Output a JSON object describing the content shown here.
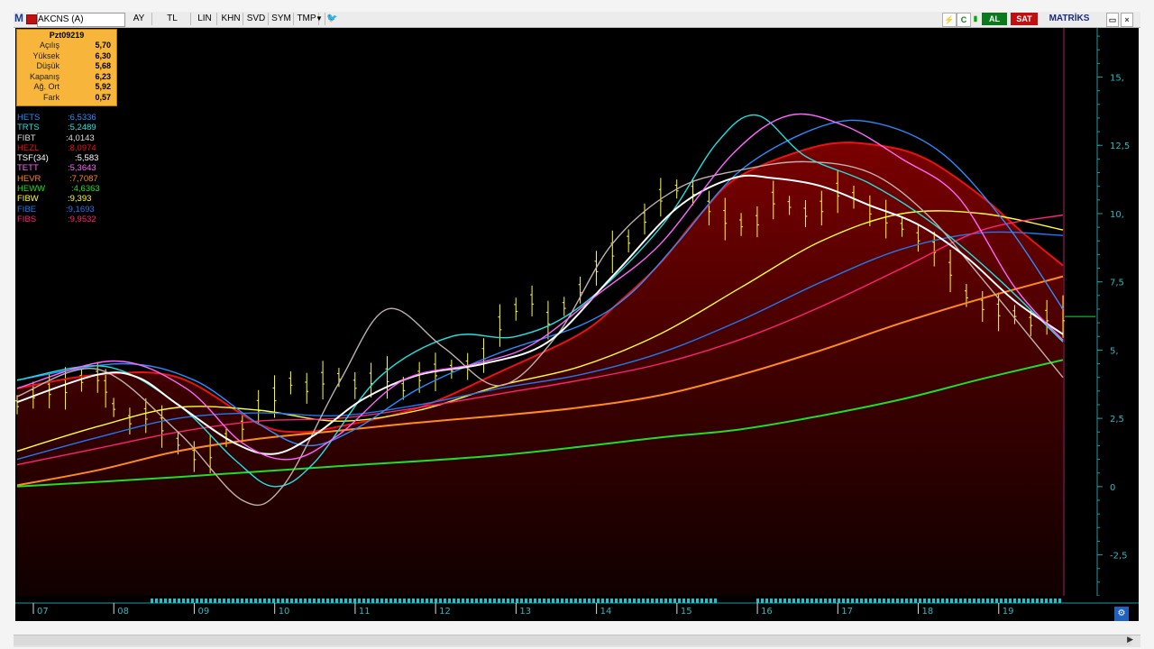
{
  "toolbar": {
    "logo": "M",
    "symbol": "AKCNS (A)",
    "buttons": [
      "AY",
      "TL",
      "LIN",
      "KHN",
      "SVD",
      "SYM",
      "TMP"
    ],
    "buy_label": "AL",
    "sell_label": "SAT",
    "brand": "MATRİKS",
    "colors": {
      "buy": "#0a7a1c",
      "sell": "#c01010",
      "brand": "#1a2a7a"
    }
  },
  "info_box": {
    "title": "Pzt09219",
    "rows": [
      {
        "label": "Açılış",
        "value": "5,70"
      },
      {
        "label": "Yüksek",
        "value": "6,30"
      },
      {
        "label": "Düşük",
        "value": "5,68"
      },
      {
        "label": "Kapanış",
        "value": "6,23"
      },
      {
        "label": "Ağ. Ort",
        "value": "5,92"
      },
      {
        "label": "Fark",
        "value": "0,57"
      }
    ]
  },
  "legend": [
    {
      "name": "HETS",
      "value": ":6,5336",
      "color": "#2a8cff"
    },
    {
      "name": "TRTS",
      "value": ":5,2489",
      "color": "#22e0e0"
    },
    {
      "name": "FIBT",
      "value": ":4,0143",
      "color": "#dddddd"
    },
    {
      "name": "HEZL",
      "value": ":8,0974",
      "color": "#ee1111"
    },
    {
      "name": "TSF(34)",
      "value": ":5,583",
      "color": "#ffffff"
    },
    {
      "name": "TETT",
      "value": ":5,3643",
      "color": "#ff66ff"
    },
    {
      "name": "HEVR",
      "value": ":7,7087",
      "color": "#ff8c1a"
    },
    {
      "name": "HEWW",
      "value": ":4,6363",
      "color": "#22dd22"
    },
    {
      "name": "FIBW",
      "value": ":9,393",
      "color": "#ffff33"
    },
    {
      "name": "FIBE",
      "value": ":9,1693",
      "color": "#2277ee"
    },
    {
      "name": "FIBS",
      "value": ":9,9532",
      "color": "#ff2277"
    }
  ],
  "chart_data": {
    "type": "line",
    "y_ticks": [
      "15,",
      "12,5",
      "10,",
      "7,5",
      "5,",
      "2,5",
      "0",
      "-2,5"
    ],
    "x_ticks": [
      "07",
      "08",
      "09",
      "10",
      "11",
      "12",
      "13",
      "14",
      "15",
      "16",
      "17",
      "18",
      "19"
    ],
    "ylim": [
      -4,
      16.8
    ],
    "x_range": [
      0,
      13
    ],
    "grid": false,
    "price_bars": {
      "points": [
        [
          0.0,
          3.0
        ],
        [
          0.2,
          3.35
        ],
        [
          0.4,
          3.5
        ],
        [
          0.6,
          3.6
        ],
        [
          0.8,
          3.9
        ],
        [
          1.0,
          4.0
        ],
        [
          1.1,
          3.6
        ],
        [
          1.2,
          2.9
        ],
        [
          1.4,
          2.4
        ],
        [
          1.6,
          2.6
        ],
        [
          1.8,
          2.2
        ],
        [
          2.0,
          1.6
        ],
        [
          2.2,
          1.1
        ],
        [
          2.4,
          1.2
        ],
        [
          2.6,
          1.8
        ],
        [
          2.8,
          2.2
        ],
        [
          3.0,
          2.9
        ],
        [
          3.2,
          3.3
        ],
        [
          3.4,
          3.8
        ],
        [
          3.6,
          3.6
        ],
        [
          3.8,
          3.9
        ],
        [
          4.0,
          4.0
        ],
        [
          4.2,
          3.7
        ],
        [
          4.4,
          3.9
        ],
        [
          4.6,
          4.0
        ],
        [
          4.8,
          3.6
        ],
        [
          5.0,
          4.0
        ],
        [
          5.2,
          4.2
        ],
        [
          5.4,
          4.3
        ],
        [
          5.6,
          4.4
        ],
        [
          5.8,
          4.8
        ],
        [
          6.0,
          5.9
        ],
        [
          6.2,
          6.5
        ],
        [
          6.4,
          6.8
        ],
        [
          6.6,
          6.1
        ],
        [
          6.8,
          6.6
        ],
        [
          7.0,
          7.2
        ],
        [
          7.2,
          8.0
        ],
        [
          7.4,
          8.6
        ],
        [
          7.6,
          9.0
        ],
        [
          7.8,
          9.8
        ],
        [
          8.0,
          10.6
        ],
        [
          8.2,
          10.9
        ],
        [
          8.4,
          10.8
        ],
        [
          8.6,
          10.2
        ],
        [
          8.8,
          9.8
        ],
        [
          9.0,
          9.6
        ],
        [
          9.2,
          9.7
        ],
        [
          9.4,
          10.5
        ],
        [
          9.6,
          10.3
        ],
        [
          9.8,
          10.0
        ],
        [
          10.0,
          10.2
        ],
        [
          10.2,
          10.8
        ],
        [
          10.4,
          10.6
        ],
        [
          10.6,
          10.1
        ],
        [
          10.8,
          9.8
        ],
        [
          11.0,
          9.5
        ],
        [
          11.2,
          9.1
        ],
        [
          11.4,
          8.7
        ],
        [
          11.6,
          7.9
        ],
        [
          11.8,
          7.0
        ],
        [
          12.0,
          6.6
        ],
        [
          12.2,
          6.4
        ],
        [
          12.4,
          6.3
        ],
        [
          12.6,
          6.0
        ],
        [
          12.8,
          6.2
        ],
        [
          13.0,
          6.23
        ]
      ],
      "color": "#ffff33"
    },
    "series": [
      {
        "name": "HEZL",
        "color": "#ee1111",
        "values": [
          [
            0,
            3.6
          ],
          [
            1,
            4.1
          ],
          [
            2,
            4.0
          ],
          [
            3,
            2.3
          ],
          [
            3.5,
            2.0
          ],
          [
            4,
            2.2
          ],
          [
            5,
            2.9
          ],
          [
            6,
            4.2
          ],
          [
            7,
            5.6
          ],
          [
            7.5,
            6.8
          ],
          [
            8,
            8.2
          ],
          [
            8.5,
            10.0
          ],
          [
            9,
            11.4
          ],
          [
            10,
            12.5
          ],
          [
            10.7,
            12.5
          ],
          [
            11.3,
            12.0
          ],
          [
            12,
            10.6
          ],
          [
            12.5,
            9.3
          ],
          [
            13,
            8.1
          ]
        ]
      },
      {
        "name": "HEVR",
        "color": "#ff8c1a",
        "values": [
          [
            0,
            0.05
          ],
          [
            1,
            0.6
          ],
          [
            2,
            1.3
          ],
          [
            3,
            1.75
          ],
          [
            4,
            2.05
          ],
          [
            5,
            2.35
          ],
          [
            6,
            2.6
          ],
          [
            7,
            2.9
          ],
          [
            8,
            3.35
          ],
          [
            9,
            4.1
          ],
          [
            10,
            5.0
          ],
          [
            11,
            6.0
          ],
          [
            12,
            6.9
          ],
          [
            13,
            7.7
          ]
        ]
      },
      {
        "name": "HEWW",
        "color": "#22dd22",
        "values": [
          [
            0,
            0.0
          ],
          [
            2,
            0.35
          ],
          [
            4,
            0.75
          ],
          [
            6,
            1.15
          ],
          [
            8,
            1.8
          ],
          [
            9,
            2.1
          ],
          [
            10,
            2.6
          ],
          [
            11,
            3.2
          ],
          [
            12,
            3.95
          ],
          [
            13,
            4.64
          ]
        ]
      },
      {
        "name": "FIBW",
        "color": "#ffff33",
        "values": [
          [
            0,
            1.3
          ],
          [
            1,
            2.2
          ],
          [
            2,
            2.9
          ],
          [
            3,
            2.8
          ],
          [
            4,
            2.4
          ],
          [
            5,
            2.8
          ],
          [
            6,
            3.7
          ],
          [
            7,
            4.4
          ],
          [
            8,
            5.6
          ],
          [
            9,
            7.3
          ],
          [
            10,
            9.0
          ],
          [
            11,
            10.0
          ],
          [
            12,
            10.0
          ],
          [
            13,
            9.4
          ]
        ]
      },
      {
        "name": "FIBE",
        "color": "#2277ee",
        "values": [
          [
            0,
            1.0
          ],
          [
            1,
            1.8
          ],
          [
            2,
            2.5
          ],
          [
            3,
            2.7
          ],
          [
            4,
            2.6
          ],
          [
            5,
            3.0
          ],
          [
            6,
            3.6
          ],
          [
            7,
            4.1
          ],
          [
            8,
            4.9
          ],
          [
            9,
            6.1
          ],
          [
            10,
            7.5
          ],
          [
            11,
            8.7
          ],
          [
            12,
            9.3
          ],
          [
            13,
            9.2
          ]
        ]
      },
      {
        "name": "FIBS",
        "color": "#ff2277",
        "values": [
          [
            0,
            0.8
          ],
          [
            1,
            1.4
          ],
          [
            2,
            2.0
          ],
          [
            3,
            2.4
          ],
          [
            4,
            2.5
          ],
          [
            5,
            2.9
          ],
          [
            6,
            3.4
          ],
          [
            7,
            3.9
          ],
          [
            8,
            4.5
          ],
          [
            9,
            5.4
          ],
          [
            10,
            6.6
          ],
          [
            11,
            8.0
          ],
          [
            12,
            9.4
          ],
          [
            13,
            9.95
          ]
        ]
      },
      {
        "name": "HETS",
        "color": "#2a8cff",
        "values": [
          [
            0,
            3.9
          ],
          [
            1.3,
            4.5
          ],
          [
            2.2,
            3.9
          ],
          [
            3,
            2.3
          ],
          [
            3.6,
            1.5
          ],
          [
            4.2,
            2.1
          ],
          [
            5,
            3.6
          ],
          [
            6,
            4.9
          ],
          [
            7,
            5.9
          ],
          [
            7.6,
            7.0
          ],
          [
            8.2,
            8.9
          ],
          [
            9,
            11.6
          ],
          [
            10,
            13.2
          ],
          [
            10.7,
            13.3
          ],
          [
            11.5,
            12.2
          ],
          [
            12.3,
            9.6
          ],
          [
            13,
            6.5
          ]
        ]
      },
      {
        "name": "TRTS",
        "color": "#22e0e0",
        "values": [
          [
            0,
            3.9
          ],
          [
            1.1,
            4.4
          ],
          [
            2,
            3.0
          ],
          [
            2.7,
            1.0
          ],
          [
            3.2,
            0.0
          ],
          [
            3.7,
            0.9
          ],
          [
            4.5,
            4.0
          ],
          [
            5.4,
            5.5
          ],
          [
            6.2,
            5.5
          ],
          [
            7,
            6.6
          ],
          [
            8,
            9.5
          ],
          [
            8.7,
            12.6
          ],
          [
            9.2,
            13.6
          ],
          [
            9.8,
            12.1
          ],
          [
            10.6,
            11.1
          ],
          [
            11.4,
            9.6
          ],
          [
            12.2,
            7.6
          ],
          [
            13,
            5.3
          ]
        ]
      },
      {
        "name": "FIBT",
        "color": "#c0b0b0",
        "values": [
          [
            0,
            3.3
          ],
          [
            1,
            4.3
          ],
          [
            2,
            2.0
          ],
          [
            2.8,
            -0.5
          ],
          [
            3.3,
            0.0
          ],
          [
            4,
            3.8
          ],
          [
            4.6,
            6.5
          ],
          [
            5.3,
            5.1
          ],
          [
            6,
            3.7
          ],
          [
            6.7,
            5.5
          ],
          [
            7.4,
            8.9
          ],
          [
            8.2,
            10.9
          ],
          [
            9,
            11.6
          ],
          [
            9.8,
            11.9
          ],
          [
            10.6,
            11.5
          ],
          [
            11.3,
            10.0
          ],
          [
            12,
            7.6
          ],
          [
            13,
            4.0
          ]
        ]
      },
      {
        "name": "TSF(34)",
        "color": "#ffffff",
        "values": [
          [
            0,
            3.1
          ],
          [
            1,
            4.1
          ],
          [
            1.5,
            4.0
          ],
          [
            2,
            3.0
          ],
          [
            2.7,
            1.6
          ],
          [
            3.2,
            1.2
          ],
          [
            3.7,
            1.9
          ],
          [
            4.3,
            3.2
          ],
          [
            5,
            4.1
          ],
          [
            5.8,
            4.5
          ],
          [
            6.6,
            5.3
          ],
          [
            7.4,
            7.7
          ],
          [
            8.2,
            10.2
          ],
          [
            8.9,
            11.3
          ],
          [
            9.4,
            11.3
          ],
          [
            10,
            11.0
          ],
          [
            10.6,
            10.3
          ],
          [
            11.2,
            9.6
          ],
          [
            11.8,
            8.4
          ],
          [
            12.4,
            6.8
          ],
          [
            13,
            5.58
          ]
        ]
      },
      {
        "name": "TETT",
        "color": "#ff66ff",
        "values": [
          [
            0,
            3.6
          ],
          [
            1.2,
            4.6
          ],
          [
            2.1,
            3.6
          ],
          [
            2.8,
            1.6
          ],
          [
            3.4,
            1.0
          ],
          [
            4,
            1.9
          ],
          [
            4.8,
            3.9
          ],
          [
            5.7,
            4.5
          ],
          [
            6.4,
            5.2
          ],
          [
            7.2,
            7.0
          ],
          [
            8.0,
            8.9
          ],
          [
            8.9,
            12.2
          ],
          [
            9.6,
            13.6
          ],
          [
            10.3,
            13.2
          ],
          [
            11,
            12.0
          ],
          [
            11.7,
            10.6
          ],
          [
            12.4,
            7.3
          ],
          [
            13,
            5.36
          ]
        ]
      }
    ]
  }
}
